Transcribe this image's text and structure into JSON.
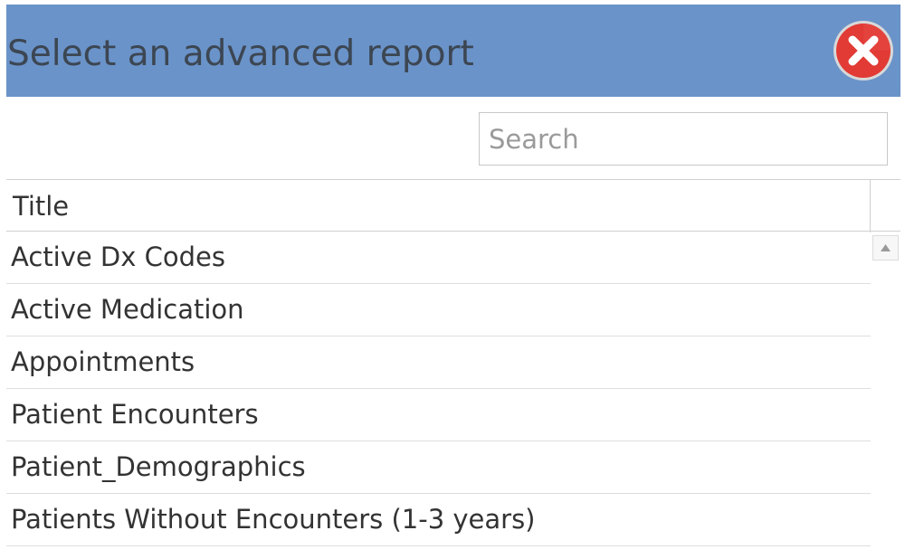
{
  "dialog": {
    "title": "Select an advanced report",
    "close_icon": "close-circle-icon"
  },
  "search": {
    "placeholder": "Search",
    "value": ""
  },
  "grid": {
    "column_header": "Title",
    "rows": [
      "Active Dx Codes",
      "Active Medication",
      "Appointments",
      "Patient Encounters",
      "Patient_Demographics",
      "Patients Without Encounters (1-3 years)"
    ],
    "scroll_up_icon": "scroll-up-arrow-icon"
  },
  "colors": {
    "titlebar": "#6a93c9",
    "close_button": "#e23a35",
    "border": "#d0d0d0"
  }
}
